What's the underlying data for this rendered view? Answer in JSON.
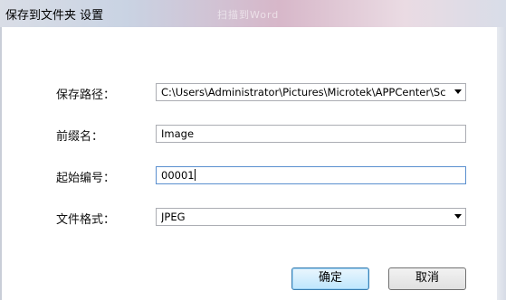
{
  "window": {
    "title": "保存到文件夹 设置",
    "ghost_title": "扫描到Word"
  },
  "form": {
    "save_path": {
      "label": "保存路径：",
      "value": "C:\\Users\\Administrator\\Pictures\\Microtek\\APPCenter\\Sc"
    },
    "prefix": {
      "label": "前缀名：",
      "value": "Image"
    },
    "start_number": {
      "label": "起始编号：",
      "value": "00001"
    },
    "file_format": {
      "label": "文件格式：",
      "value": "JPEG"
    }
  },
  "buttons": {
    "ok": "确定",
    "cancel": "取消"
  },
  "icons": [
    "chevron-down-icon"
  ]
}
